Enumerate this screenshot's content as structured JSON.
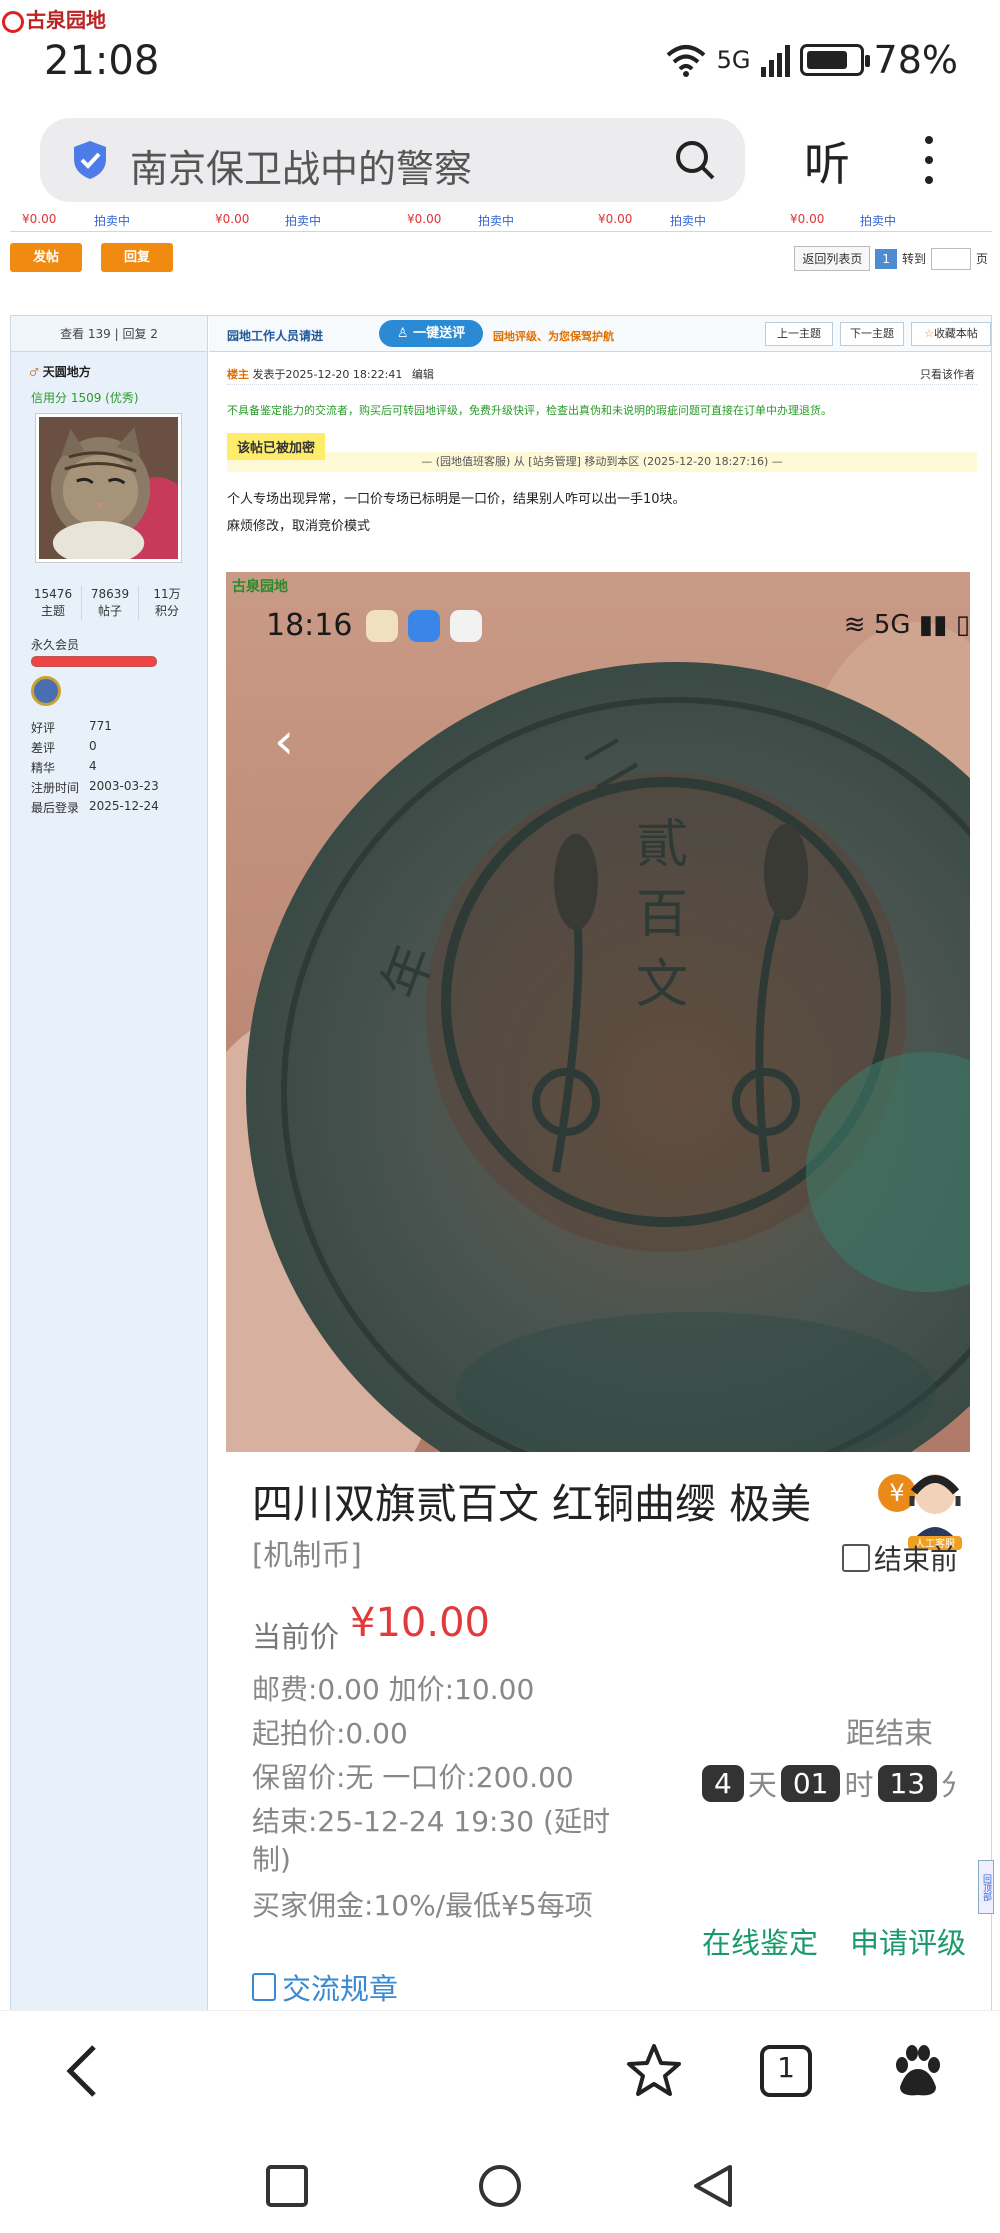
{
  "status_bar": {
    "app": "古泉园地",
    "time": "21:08",
    "net": "5G",
    "battery": "78%"
  },
  "browser": {
    "address": "南京保卫战中的警察",
    "listen": "听"
  },
  "price_strip": {
    "items": [
      {
        "price": "¥0.00",
        "status": "拍卖中"
      },
      {
        "price": "¥0.00",
        "status": "拍卖中"
      },
      {
        "price": "¥0.00",
        "status": "拍卖中"
      },
      {
        "price": "¥0.00",
        "status": "拍卖中"
      },
      {
        "price": "¥0.00",
        "status": "拍卖中"
      }
    ]
  },
  "actions": {
    "post": "发帖",
    "reply": "回复"
  },
  "pager": {
    "back": "返回列表页",
    "current": "1",
    "goto": "转到",
    "page": "页"
  },
  "sidebar": {
    "views_replies": "查看 139 | 回复 2",
    "author": "天圆地方",
    "credit": "信用分 1509 (优秀)",
    "stats": [
      {
        "value": "15476",
        "label": "主题"
      },
      {
        "value": "78639",
        "label": "帖子"
      },
      {
        "value": "11万",
        "label": "积分"
      }
    ],
    "rank": "永久会员",
    "info": [
      {
        "k": "好评",
        "v": "771"
      },
      {
        "k": "差评",
        "v": "0"
      },
      {
        "k": "精华",
        "v": "4"
      },
      {
        "k": "注册时间",
        "v": "2003-03-23"
      },
      {
        "k": "最后登录",
        "v": "2025-12-24"
      }
    ]
  },
  "post_header": {
    "notice": "园地工作人员请进",
    "eval_button": "一键送评",
    "tip": "园地评级、为您保驾护航",
    "prev": "上一主题",
    "next": "下一主题",
    "favorite": "收藏本帖"
  },
  "post_meta": {
    "floor": "楼主",
    "posted": "发表于2025-12-20 18:22:41",
    "edit": "编辑",
    "only_author": "只看该作者"
  },
  "post": {
    "warning": "不具备鉴定能力的交流者，购买后可转园地评级，免费升级快评，检查出真伪和未说明的瑕疵问题可直接在订单中办理退货。",
    "locked": "该帖已被加密",
    "moved": "— (园地值班客服) 从 [站务管理] 移动到本区 (2025-12-20 18:27:16) —",
    "line1": "个人专场出现异常，一口价专场已标明是一口价，结果别人咋可以出一手10块。",
    "line2": "麻烦修改，取消竞价模式"
  },
  "screenshot": {
    "logo": "古泉园地",
    "time": "18:16",
    "net": "5G"
  },
  "auction": {
    "title": "四川双旗贰百文 红铜曲缨 极美",
    "yen": "¥",
    "category": "[机制币]",
    "follow": "结束前",
    "agent_label": "人工客服",
    "price_label": "当前价",
    "price": "¥10.00",
    "shipping": "邮费:0.00  加价:10.00",
    "start": "起拍价:0.00",
    "reserve": "保留价:无  一口价:200.00",
    "end1": "结束:25-12-24 19:30 (延时",
    "end2": "制)",
    "commission": "买家佣金:10%/最低¥5每项",
    "end_label": "距结束",
    "days": "4",
    "days_u": "天",
    "hours": "01",
    "hours_u": "时",
    "mins": "13",
    "mins_u": "分",
    "appraise": "在线鉴定",
    "grade": "申请评级",
    "rules": "交流规章"
  },
  "side_tab": "回顶部",
  "tabs_count": "1",
  "colors": {
    "accent_orange": "#f08a10",
    "link_blue": "#2a8ad3",
    "price_red": "#e03a3a",
    "green": "#1a9a6a"
  }
}
